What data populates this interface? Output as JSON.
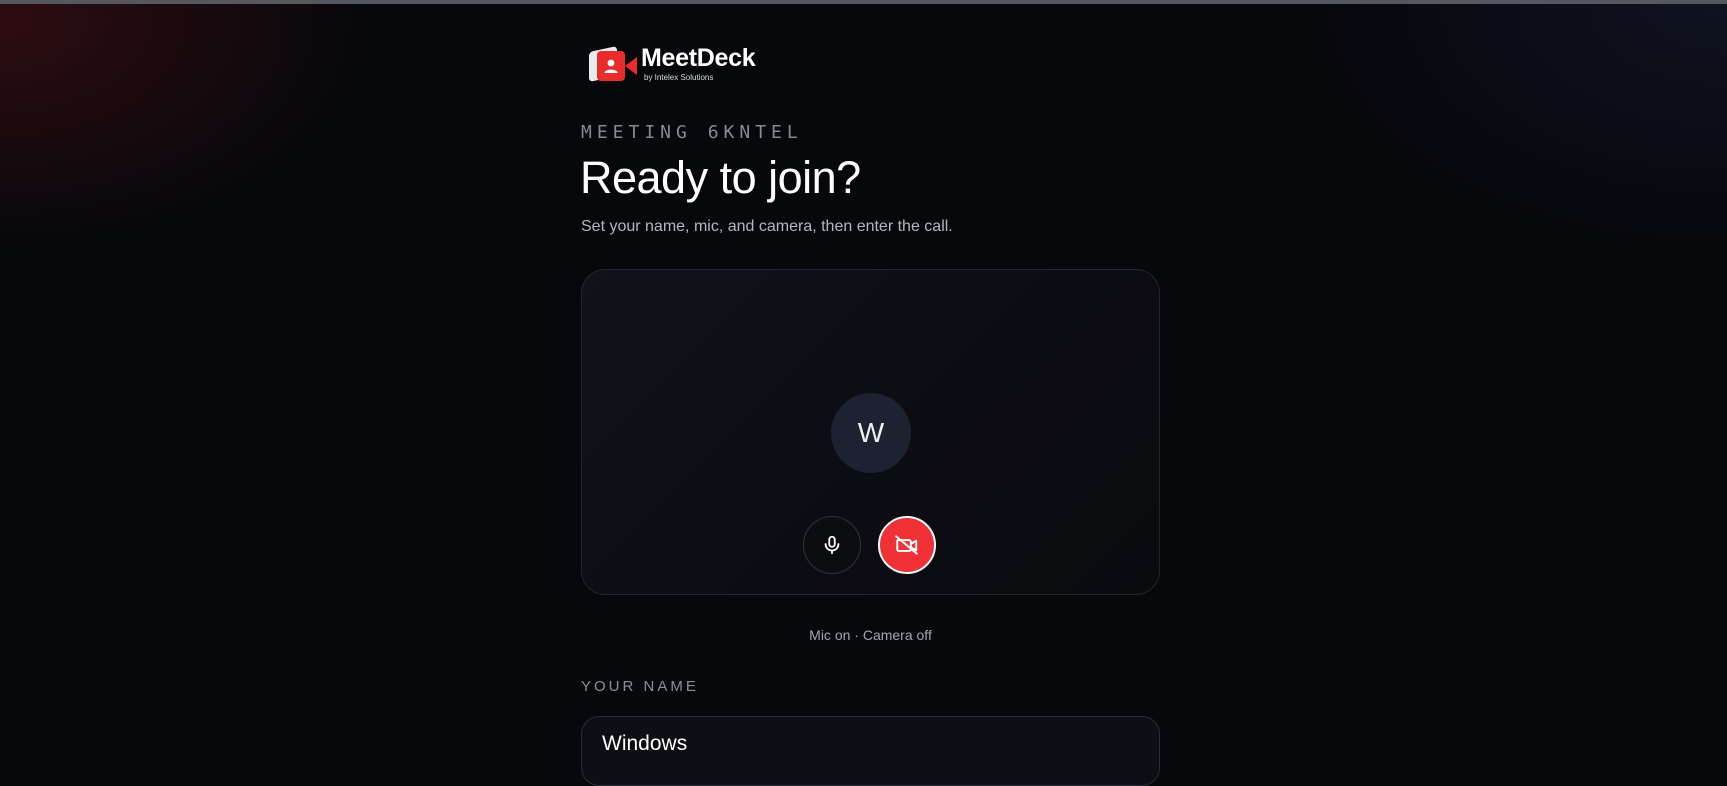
{
  "app": {
    "logo_name": "MeetDeck",
    "logo_subtitle": "by Intelex Solutions",
    "brand_color": "#ea2b2b",
    "logo_icon": "camera-user-icon"
  },
  "meeting": {
    "eyebrow": "MEETING 6KNTEL",
    "heading": "Ready to join?",
    "subtitle": "Set your name, mic, and camera, then enter the call."
  },
  "preview": {
    "avatar_initial": "W",
    "mic_button": {
      "icon": "microphone-icon",
      "state": "on"
    },
    "camera_button": {
      "icon": "camera-off-icon",
      "state": "off",
      "color": "#f03236"
    },
    "status": "Mic on · Camera off"
  },
  "name_field": {
    "label": "YOUR NAME",
    "value": "Windows"
  }
}
